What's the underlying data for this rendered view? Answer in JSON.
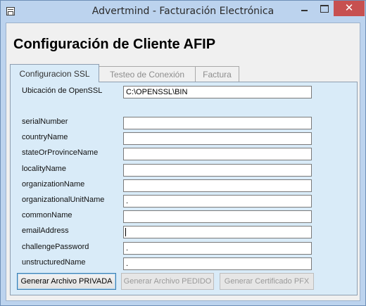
{
  "window": {
    "title": "Advertmind - Facturación Electrónica",
    "close_glyph": "✕"
  },
  "form": {
    "heading": "Configuración de Cliente AFIP"
  },
  "tabs": [
    {
      "label": "Configuracion SSL",
      "active": true
    },
    {
      "label": "Testeo de Conexión",
      "active": false
    },
    {
      "label": "Factura",
      "active": false
    }
  ],
  "ssl": {
    "openssl_label": "Ubicación de OpenSSL",
    "openssl_value": "C:\\OPENSSL\\BIN",
    "fields": [
      {
        "label": "serialNumber",
        "value": ""
      },
      {
        "label": "countryName",
        "value": ""
      },
      {
        "label": "stateOrProvinceName",
        "value": ""
      },
      {
        "label": "localityName",
        "value": ""
      },
      {
        "label": "organizationName",
        "value": ""
      },
      {
        "label": "organizationalUnitName",
        "value": "."
      },
      {
        "label": "commonName",
        "value": ""
      },
      {
        "label": "emailAddress",
        "value": ""
      },
      {
        "label": "challengePassword",
        "value": "."
      },
      {
        "label": "unstructuredName",
        "value": "."
      }
    ]
  },
  "buttons": {
    "private_label": "Generar Archivo PRIVADA",
    "request_label": "Generar Archivo PEDIDO",
    "pfx_label": "Generar Certificado PFX"
  }
}
